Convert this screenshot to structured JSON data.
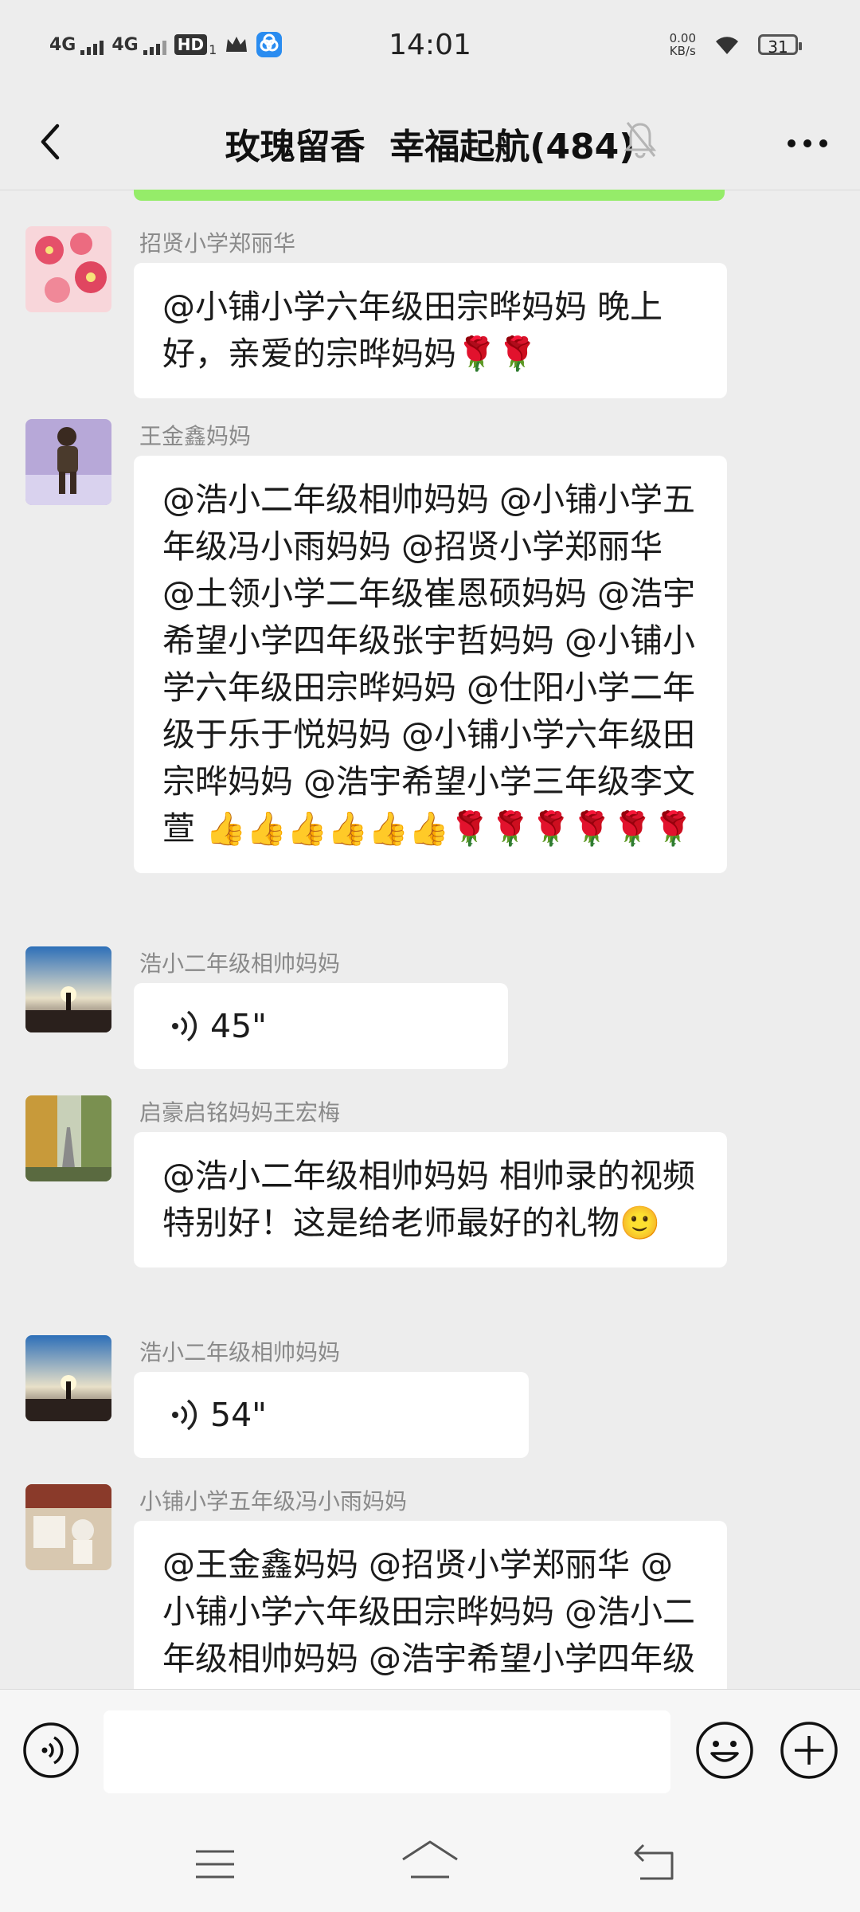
{
  "status_bar": {
    "signal1": "4G",
    "signal2": "4G",
    "hd": "HD",
    "hd_sub": "1",
    "time": "14:01",
    "net_speed_value": "0.00",
    "net_speed_unit": "KB/s",
    "battery": "31"
  },
  "header": {
    "title": "玫瑰留香  幸福起航(484)"
  },
  "messages": [
    {
      "sender": "招贤小学郑丽华",
      "text": "@小铺小学六年级田宗晔妈妈  晚上好，亲爱的宗晔妈妈🌹🌹"
    },
    {
      "sender": "王金鑫妈妈",
      "text": "@浩小二年级相帅妈妈 @小铺小学五年级冯小雨妈妈 @招贤小学郑丽华 @土领小学二年级崔恩硕妈妈 @浩宇希望小学四年级张宇哲妈妈 @小铺小学六年级田宗晔妈妈 @仕阳小学二年级于乐于悦妈妈 @小铺小学六年级田宗晔妈妈 @浩宇希望小学三年级李文萱 👍👍👍👍👍👍🌹🌹🌹🌹🌹🌹"
    },
    {
      "sender": "浩小二年级相帅妈妈",
      "voice_duration": "45\""
    },
    {
      "sender": "启豪启铭妈妈王宏梅",
      "text": "@浩小二年级相帅妈妈  相帅录的视频特别好！这是给老师最好的礼物🙂"
    },
    {
      "sender": "浩小二年级相帅妈妈",
      "voice_duration": "54\""
    },
    {
      "sender": "小铺小学五年级冯小雨妈妈",
      "text": "@王金鑫妈妈 @招贤小学郑丽华 @小铺小学六年级田宗晔妈妈 @浩小二年级相帅妈妈 @浩宇希望小学四年级张宇哲妈妈 @土领小学二年级崔恩硕妈妈"
    }
  ],
  "input": {
    "value": "",
    "placeholder": ""
  },
  "icons": {
    "back": "chevron-left-icon",
    "mute": "bell-off-icon",
    "more": "more-dots-icon",
    "voice_input": "voice-input-icon",
    "emoji": "emoji-icon",
    "plus": "plus-icon"
  },
  "colors": {
    "background": "#ededed",
    "bubble": "#ffffff",
    "accent_green": "#95ec69",
    "sender_name": "#8a8a8a"
  }
}
